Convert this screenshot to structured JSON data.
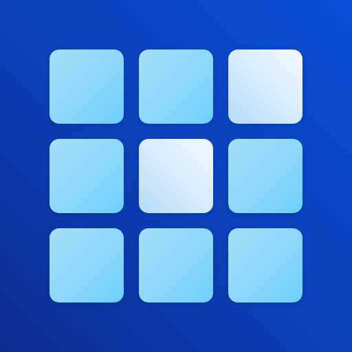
{
  "app_icon": {
    "icon_name": "grid-3x3-icon",
    "colors": {
      "background_start": "#0a2d8f",
      "background_end": "#0a4fd9",
      "tile_normal": "#8fd8fb",
      "tile_highlight": "#eaf5ff"
    },
    "grid": {
      "rows": 3,
      "columns": 3,
      "tiles": [
        {
          "row": 1,
          "column": 1,
          "state": "normal"
        },
        {
          "row": 1,
          "column": 2,
          "state": "normal"
        },
        {
          "row": 1,
          "column": 3,
          "state": "highlight"
        },
        {
          "row": 2,
          "column": 1,
          "state": "normal"
        },
        {
          "row": 2,
          "column": 2,
          "state": "highlight"
        },
        {
          "row": 2,
          "column": 3,
          "state": "normal"
        },
        {
          "row": 3,
          "column": 1,
          "state": "normal"
        },
        {
          "row": 3,
          "column": 2,
          "state": "normal"
        },
        {
          "row": 3,
          "column": 3,
          "state": "normal"
        }
      ]
    }
  }
}
